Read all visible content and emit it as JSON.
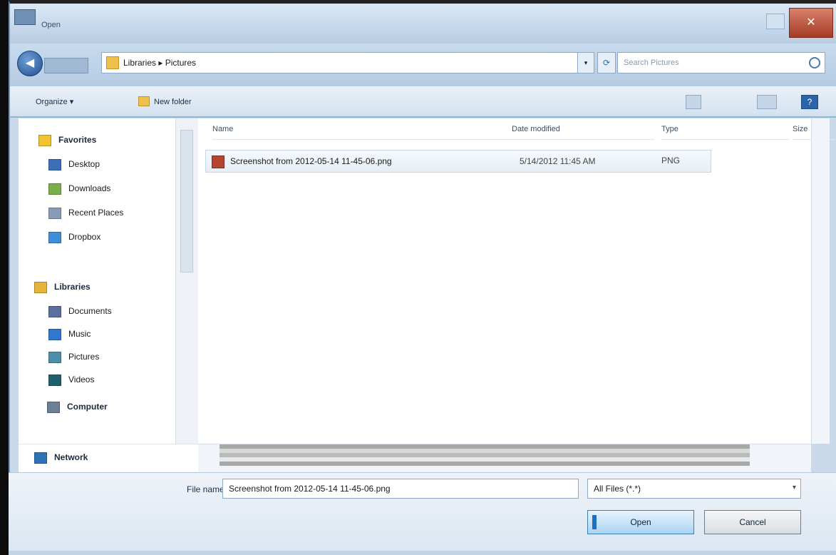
{
  "window": {
    "title": "Open",
    "close_glyph": "✕"
  },
  "navigation": {
    "back_glyph": "◀",
    "address_path": "Libraries ▸ Pictures",
    "address_dropdown_glyph": "▾",
    "refresh_glyph": "⟳",
    "search_placeholder": "Search Pictures"
  },
  "toolbar": {
    "organize_label": "Organize ▾",
    "new_folder_label": "New folder",
    "help_glyph": "?"
  },
  "nav_pane": {
    "favorites": [
      {
        "label": "Favorites",
        "icon": "star-icon",
        "color": "#f2c230",
        "group": true
      },
      {
        "label": "Desktop",
        "icon": "desktop-icon",
        "color": "#3c6fb8"
      },
      {
        "label": "Downloads",
        "icon": "downloads-icon",
        "color": "#7ab04b"
      },
      {
        "label": "Recent Places",
        "icon": "recent-places-icon",
        "color": "#8a9bb5"
      },
      {
        "label": "Dropbox",
        "icon": "dropbox-icon",
        "color": "#3f8fd8"
      }
    ],
    "libraries": [
      {
        "label": "Libraries",
        "icon": "libraries-icon",
        "color": "#e7b43b",
        "group": true
      },
      {
        "label": "Documents",
        "icon": "documents-icon",
        "color": "#5a6fa0"
      },
      {
        "label": "Music",
        "icon": "music-icon",
        "color": "#2f78d0"
      },
      {
        "label": "Pictures",
        "icon": "pictures-icon",
        "color": "#4e8fa8"
      },
      {
        "label": "Videos",
        "icon": "videos-icon",
        "color": "#1f5f6e"
      }
    ],
    "computer": {
      "label": "Computer",
      "icon": "computer-icon",
      "color": "#6b7f99"
    },
    "network": {
      "label": "Network",
      "icon": "network-icon",
      "color": "#2e72b8"
    }
  },
  "file_list": {
    "columns": {
      "name": "Name",
      "date": "Date modified",
      "type": "Type",
      "size": "Size"
    },
    "rows": [
      {
        "name": "Screenshot from 2012-05-14 11-45-06.png",
        "date": "5/14/2012 11:45 AM",
        "type": "PNG"
      }
    ]
  },
  "bottom": {
    "filename_label": "File name:",
    "filename_value": "Screenshot from 2012-05-14 11-45-06.png",
    "filetype_value": "All Files (*.*)",
    "select_arrow": "▾",
    "open_label": "Open",
    "cancel_label": "Cancel"
  }
}
